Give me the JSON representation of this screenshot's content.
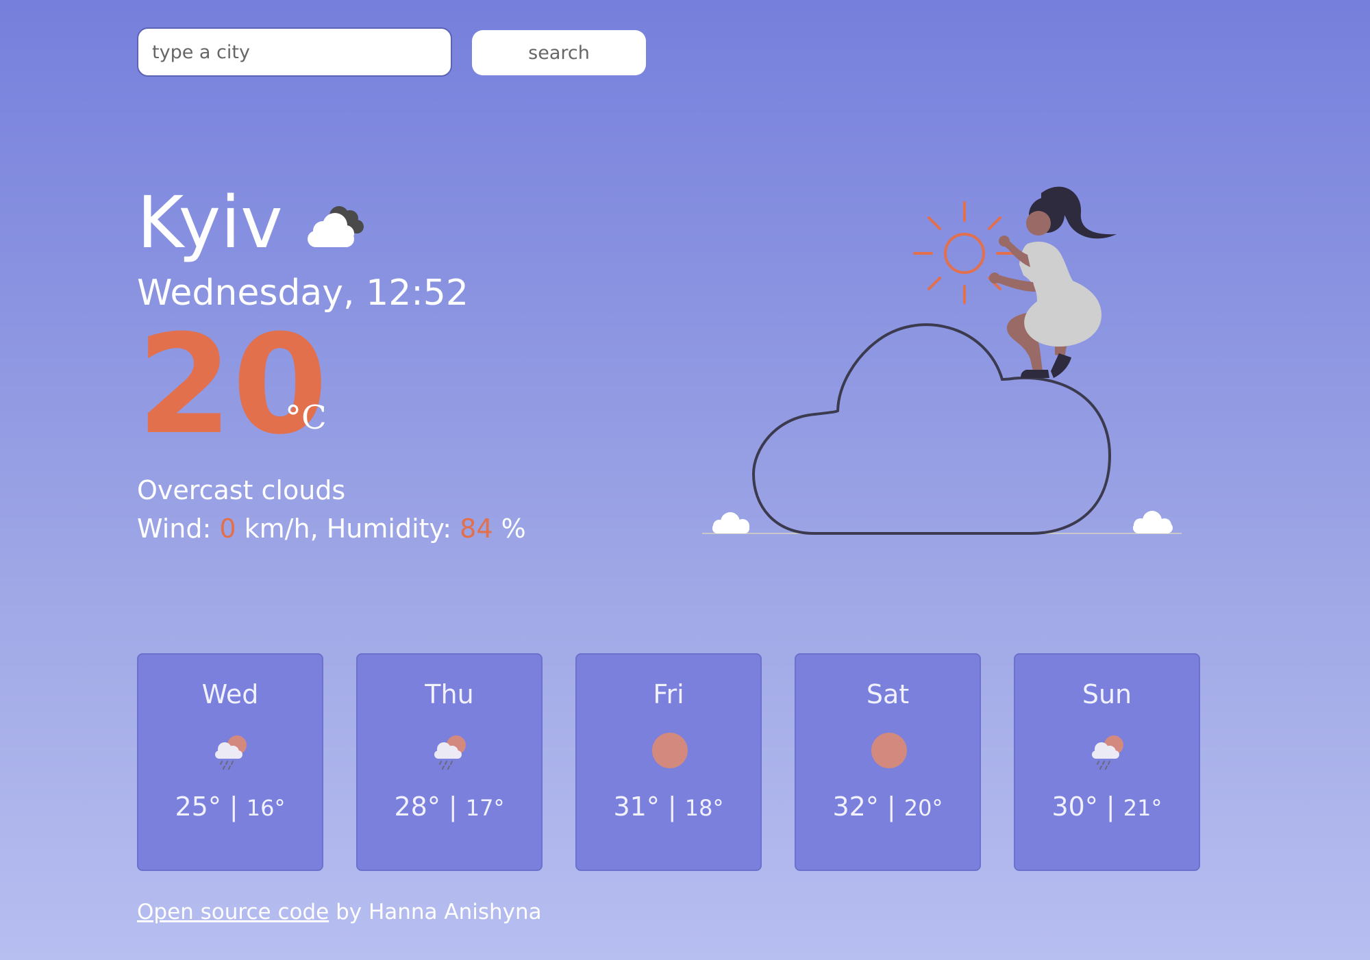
{
  "search": {
    "placeholder": "type a city",
    "button_label": "search"
  },
  "current": {
    "city": "Kyiv",
    "icon": "overcast-clouds-icon",
    "day_time": "Wednesday, 12:52",
    "temperature": "20",
    "unit": "°C",
    "description": "Overcast clouds",
    "wind_label": "Wind: ",
    "wind_value": "0",
    "wind_unit": " km/h, Humidity: ",
    "humidity_value": "84",
    "humidity_unit": " %"
  },
  "forecast": [
    {
      "day": "Wed",
      "icon": "rain-sun-icon",
      "max": "25°",
      "sep": " | ",
      "min": "16°"
    },
    {
      "day": "Thu",
      "icon": "rain-sun-icon",
      "max": "28°",
      "sep": " | ",
      "min": "17°"
    },
    {
      "day": "Fri",
      "icon": "sun-icon",
      "max": "31°",
      "sep": " | ",
      "min": "18°"
    },
    {
      "day": "Sat",
      "icon": "sun-icon",
      "max": "32°",
      "sep": " | ",
      "min": "20°"
    },
    {
      "day": "Sun",
      "icon": "rain-sun-icon",
      "max": "30°",
      "sep": " | ",
      "min": "21°"
    }
  ],
  "footer": {
    "link_text": "Open source code",
    "suffix": " by Hanna Anishyna"
  },
  "colors": {
    "accent": "#e2704c",
    "card": "#7a80dc",
    "sun": "#d4897f"
  }
}
